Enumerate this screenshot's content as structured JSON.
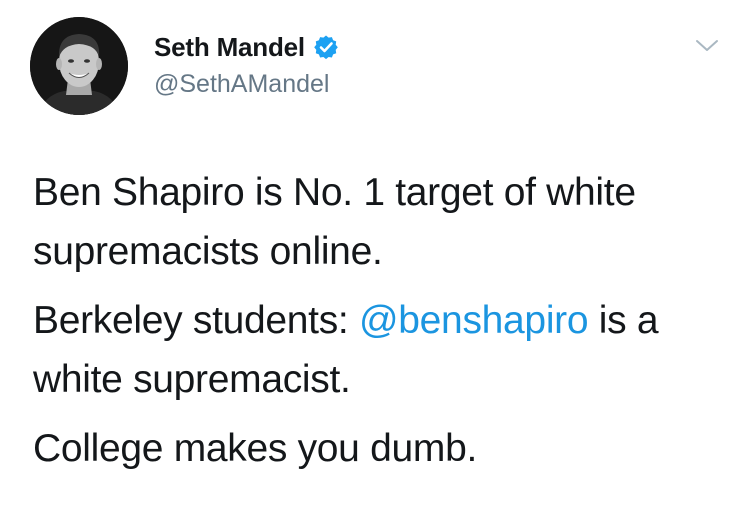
{
  "tweet": {
    "author": {
      "display_name": "Seth Mandel",
      "handle": "@SethAMandel",
      "verified": true
    },
    "text": {
      "paragraph_1": "Ben Shapiro is No. 1 target of white supremacists online.",
      "paragraph_2_before": "Berkeley students: ",
      "paragraph_2_mention": "@benshapiro",
      "paragraph_2_after": " is a white supremacist.",
      "paragraph_3": "College makes you dumb."
    },
    "icons": {
      "verified": "verified-badge-icon",
      "menu": "chevron-down-icon",
      "avatar": "profile-photo"
    },
    "colors": {
      "text": "#14171a",
      "secondary": "#657786",
      "link": "#1b95e0",
      "verified": "#1da1f2"
    }
  }
}
